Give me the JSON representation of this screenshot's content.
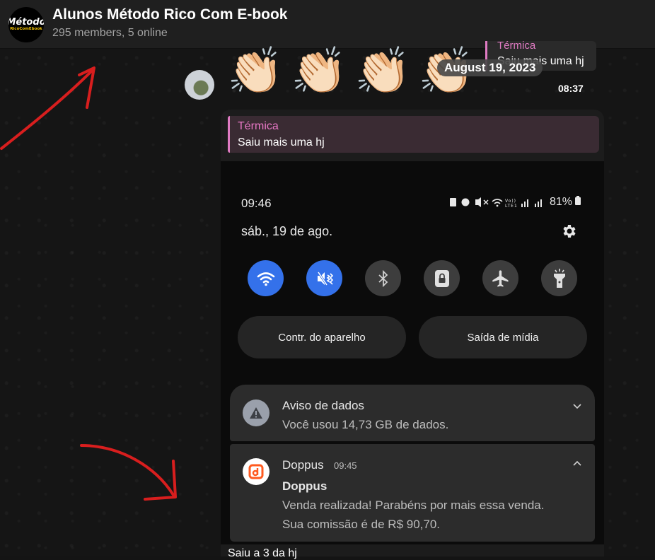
{
  "header": {
    "avatar_line1": "Método",
    "avatar_line2": "RicoComEbook",
    "title": "Alunos Método Rico Com E-book",
    "subtitle": "295 members, 5 online"
  },
  "feed": {
    "claps": [
      "👏🏻",
      "👏🏻",
      "👏🏻",
      "👏🏻"
    ],
    "top_reply_name": "Térmica",
    "top_reply_text": "Saiu mais uma hj",
    "date_pill": "August 19, 2023",
    "top_time": "08:37"
  },
  "message": {
    "reply_name": "Térmica",
    "reply_text": "Saiu mais uma hj",
    "bottom_text": "Saiu a 3 da hj"
  },
  "phone": {
    "status_time": "09:46",
    "battery": "81%",
    "date": "sáb., 19 de ago.",
    "quick_settings": [
      {
        "name": "wifi-icon",
        "active": true
      },
      {
        "name": "mute-icon",
        "active": true
      },
      {
        "name": "bluetooth-icon",
        "active": false
      },
      {
        "name": "rotation-lock-icon",
        "active": false
      },
      {
        "name": "airplane-icon",
        "active": false
      },
      {
        "name": "flashlight-icon",
        "active": false
      }
    ],
    "pill_left": "Contr. do aparelho",
    "pill_right": "Saída de mídia",
    "notifications": [
      {
        "title": "Aviso de dados",
        "text": "Você usou 14,73 GB de dados."
      },
      {
        "app": "Doppus",
        "time": "09:45",
        "title": "Doppus",
        "line1": "Venda realizada! Parabéns por mais essa venda.",
        "line2": "Sua comissão é de R$ 90,70."
      }
    ]
  },
  "colors": {
    "accent_blue": "#3471ea",
    "reply_pink": "#e07bc3",
    "annotation_red": "#d81e1e",
    "doppus_orange": "#ff5a1f"
  }
}
